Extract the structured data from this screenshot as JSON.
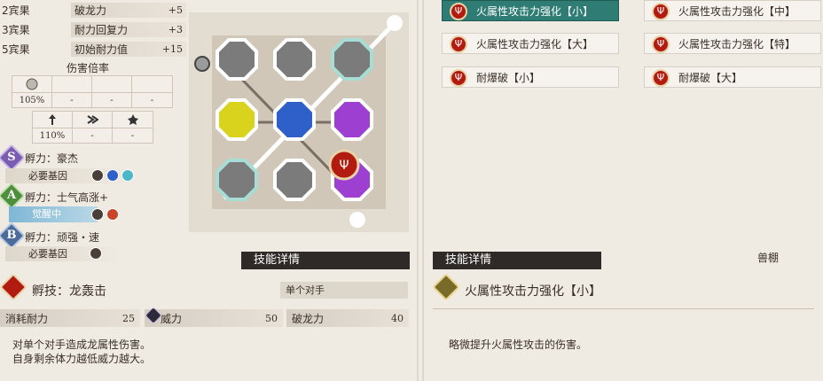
{
  "genes": [
    {
      "slot": "2宾果",
      "name": "破龙力",
      "value": "+5"
    },
    {
      "slot": "3宾果",
      "name": "耐力回复力",
      "value": "+3"
    },
    {
      "slot": "5宾果",
      "name": "初始耐力值",
      "value": "+15"
    }
  ],
  "damage_title": "伤害倍率",
  "mult1": {
    "values": [
      "105%",
      "-",
      "-",
      "-"
    ]
  },
  "mult2": {
    "values": [
      "110%",
      "-",
      "-"
    ]
  },
  "kinship": [
    {
      "letter": "S",
      "label": "孵力：豪杰",
      "req_label": "必要基因"
    },
    {
      "letter": "A",
      "label": "孵力：士气高涨+",
      "awake_label": "觉醒中"
    },
    {
      "letter": "B",
      "label": "孵力：顽强・速",
      "req_label": "必要基因"
    }
  ],
  "skill_detail_header": "技能详情",
  "left_skill": {
    "name": "孵技：龙轰击",
    "target": "单个对手",
    "stats": [
      {
        "name": "消耗耐力",
        "value": "25"
      },
      {
        "name": "威力",
        "value": "50"
      },
      {
        "name": "破龙力",
        "value": "40"
      }
    ],
    "desc_lines": [
      "对单个对手造成龙属性伤害。",
      "自身剩余体力越低威力越大。"
    ]
  },
  "right_skill": {
    "header": "技能详情",
    "category": "兽棚",
    "name": "火属性攻击力强化【小】",
    "desc": "略微提升火属性攻击的伤害。"
  },
  "skill_cards": [
    {
      "label": "火属性攻击力强化【小】",
      "active": true
    },
    {
      "label": "火属性攻击力强化【中】",
      "active": false
    },
    {
      "label": "火属性攻击力强化【大】",
      "active": false
    },
    {
      "label": "火属性攻击力强化【特】",
      "active": false
    },
    {
      "label": "耐爆破【小】",
      "active": false
    },
    {
      "label": "耐爆破【大】",
      "active": false
    }
  ],
  "colors": {
    "accent": "#2e7c73",
    "fire": "#b21c10",
    "yellow": "#d9d31e",
    "blue": "#2f5fc9",
    "purple": "#9d3fd0"
  }
}
